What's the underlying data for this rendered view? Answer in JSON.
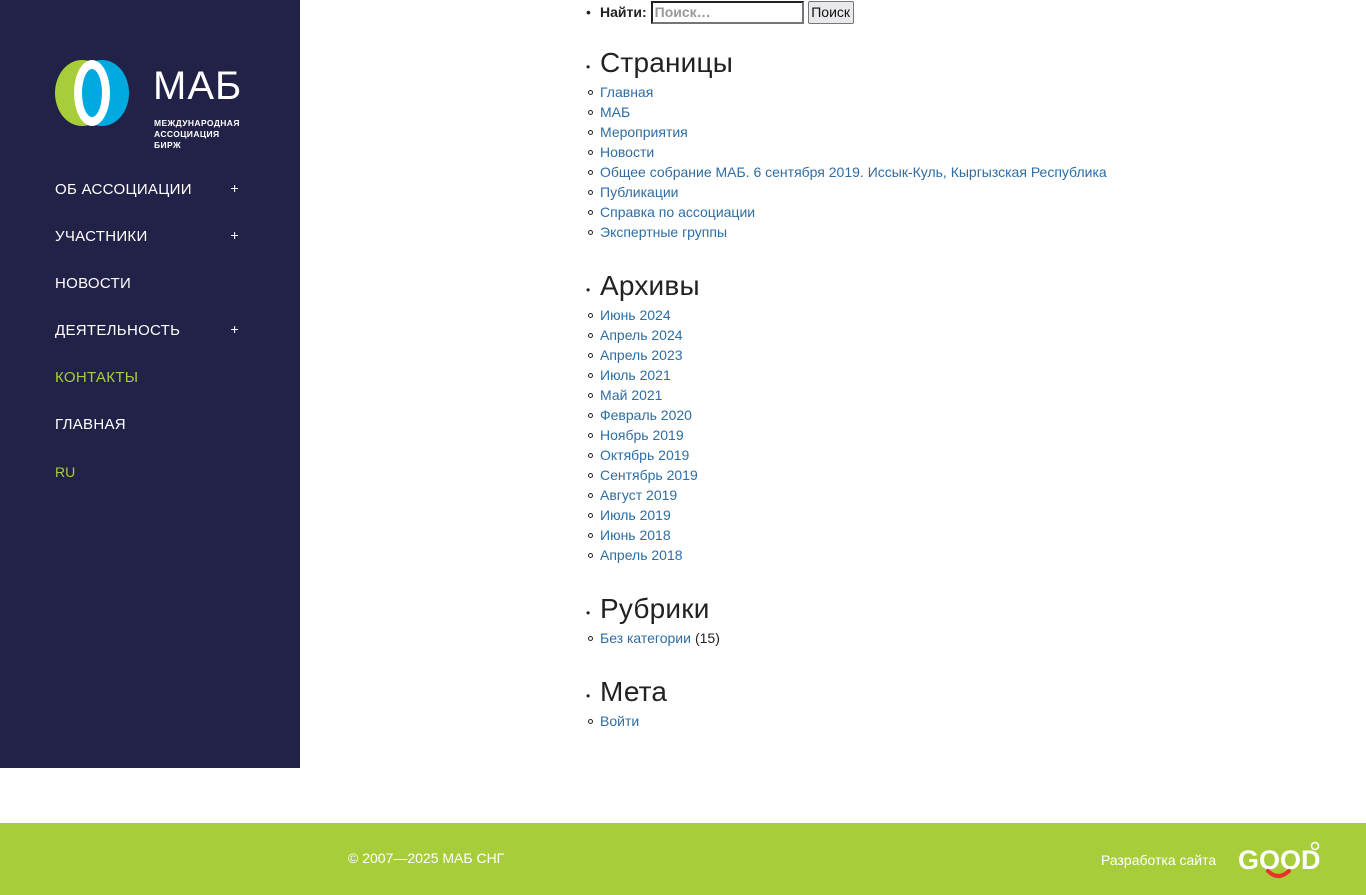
{
  "brand": {
    "name": "МАБ",
    "subtitle_lines": [
      "МЕЖДУНАРОДНАЯ",
      "АССОЦИАЦИЯ",
      "БИРЖ"
    ],
    "colors": {
      "green": "#a8cd3a",
      "blue": "#00a9e0",
      "navy": "#222249"
    }
  },
  "nav": {
    "items": [
      {
        "label": "ОБ АССОЦИАЦИИ",
        "expandable": true,
        "plus": "+"
      },
      {
        "label": "УЧАСТНИКИ",
        "expandable": true,
        "plus": "+"
      },
      {
        "label": "НОВОСТИ",
        "expandable": false
      },
      {
        "label": "ДЕЯТЕЛЬНОСТЬ",
        "expandable": true,
        "plus": "+"
      },
      {
        "label": "КОНТАКТЫ",
        "expandable": false,
        "active": true
      },
      {
        "label": "ГЛАВНАЯ",
        "expandable": false
      }
    ],
    "lang": "RU"
  },
  "search": {
    "label": "Найти:",
    "placeholder": "Поиск…",
    "button": "Поиск"
  },
  "widgets": {
    "pages": {
      "title": "Страницы",
      "items": [
        "Главная",
        "МАБ",
        "Мероприятия",
        "Новости",
        "Общее собрание МАБ. 6 сентября 2019. Иссык-Куль, Кыргызская Республика",
        "Публикации",
        "Справка по ассоциации",
        "Экспертные группы"
      ]
    },
    "archives": {
      "title": "Архивы",
      "items": [
        "Июнь 2024",
        "Апрель 2024",
        "Апрель 2023",
        "Июль 2021",
        "Май 2021",
        "Февраль 2020",
        "Ноябрь 2019",
        "Октябрь 2019",
        "Сентябрь 2019",
        "Август 2019",
        "Июль 2019",
        "Июнь 2018",
        "Апрель 2018"
      ]
    },
    "categories": {
      "title": "Рубрики",
      "items": [
        {
          "label": "Без категории",
          "count": "(15)"
        }
      ]
    },
    "meta": {
      "title": "Мета",
      "items": [
        "Войти"
      ]
    }
  },
  "footer": {
    "copyright": "© 2007—2025 МАБ СНГ",
    "dev_label": "Разработка сайта",
    "dev_brand": "GOOD"
  }
}
